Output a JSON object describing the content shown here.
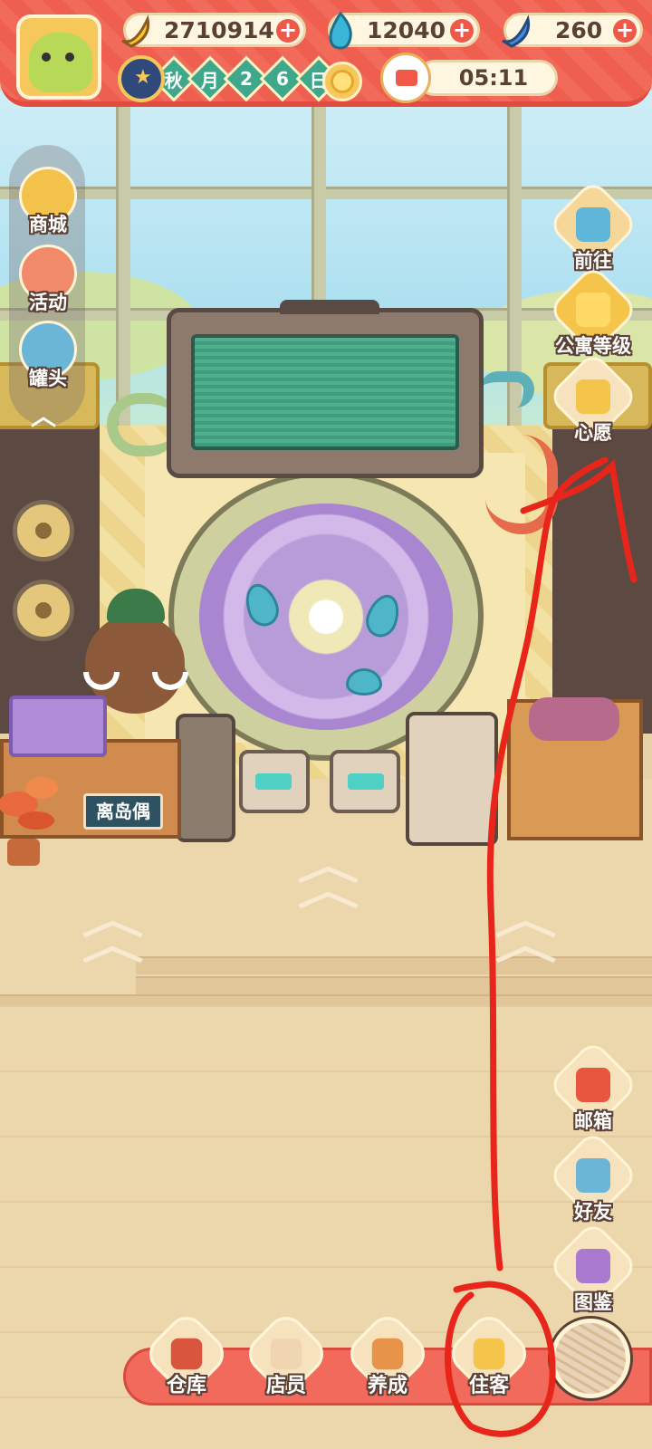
{
  "currencies": [
    {
      "icon": "banana-icon",
      "value": "2710914"
    },
    {
      "icon": "blue-flame-icon",
      "value": "12040"
    },
    {
      "icon": "blue-banana-icon",
      "value": "260"
    }
  ],
  "date": {
    "chars": [
      "秋",
      "月",
      "2",
      "6",
      "日"
    ]
  },
  "timer": {
    "value": "05:11"
  },
  "left_menu": [
    {
      "label": "商城",
      "icon": "shop-icon"
    },
    {
      "label": "活动",
      "icon": "gift-icon"
    },
    {
      "label": "罐头",
      "icon": "can-icon"
    }
  ],
  "right_menu": [
    {
      "label": "前往",
      "icon": "map-pin-icon"
    },
    {
      "label": "公寓等级",
      "icon": "apartment-level-icon"
    },
    {
      "label": "心愿",
      "icon": "wish-book-icon"
    },
    {
      "label": "邮箱",
      "icon": "mailbox-icon"
    },
    {
      "label": "好友",
      "icon": "friends-icon"
    },
    {
      "label": "图鉴",
      "icon": "collection-book-icon"
    }
  ],
  "counter_sign": "离岛偶",
  "dock": [
    {
      "label": "仓库",
      "icon": "warehouse-icon"
    },
    {
      "label": "店员",
      "icon": "staff-cat-icon"
    },
    {
      "label": "养成",
      "icon": "train-cat-icon"
    },
    {
      "label": "住客",
      "icon": "resident-icon"
    }
  ],
  "colors": {
    "accent": "#f26a5a",
    "annotation": "#e8251a"
  }
}
